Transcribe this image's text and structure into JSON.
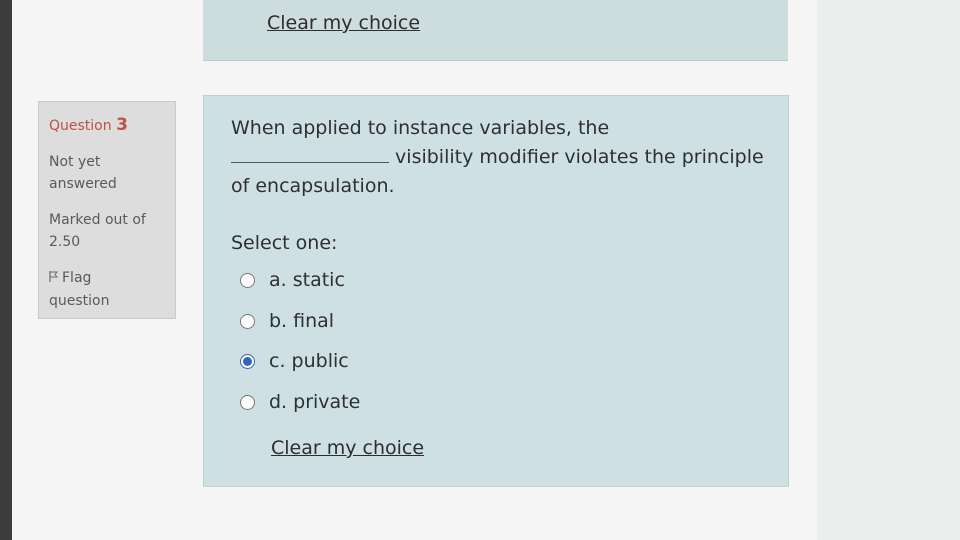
{
  "top_panel": {
    "clear_label": "Clear my choice"
  },
  "question_info": {
    "question_label": "Question",
    "question_number": "3",
    "status_line1": "Not yet",
    "status_line2": "answered",
    "marked_line1": "Marked out of",
    "marked_line2": "2.50",
    "flag_icon": "flag-icon",
    "flag_line1": "Flag",
    "flag_line2": "question"
  },
  "question": {
    "line1": "When applied to instance variables, the",
    "line2_after_blank": "visibility modifier violates the principle",
    "line3": "of encapsulation.",
    "select_prompt": "Select one:",
    "options": [
      {
        "label": "a. static",
        "selected": false
      },
      {
        "label": "b. final",
        "selected": false
      },
      {
        "label": "c. public",
        "selected": true
      },
      {
        "label": "d. private",
        "selected": false
      }
    ],
    "clear_label": "Clear my choice"
  },
  "colors": {
    "accent": "#2f64c8",
    "question_number": "#c0504a",
    "panel_bg": "#cfe0e4"
  }
}
